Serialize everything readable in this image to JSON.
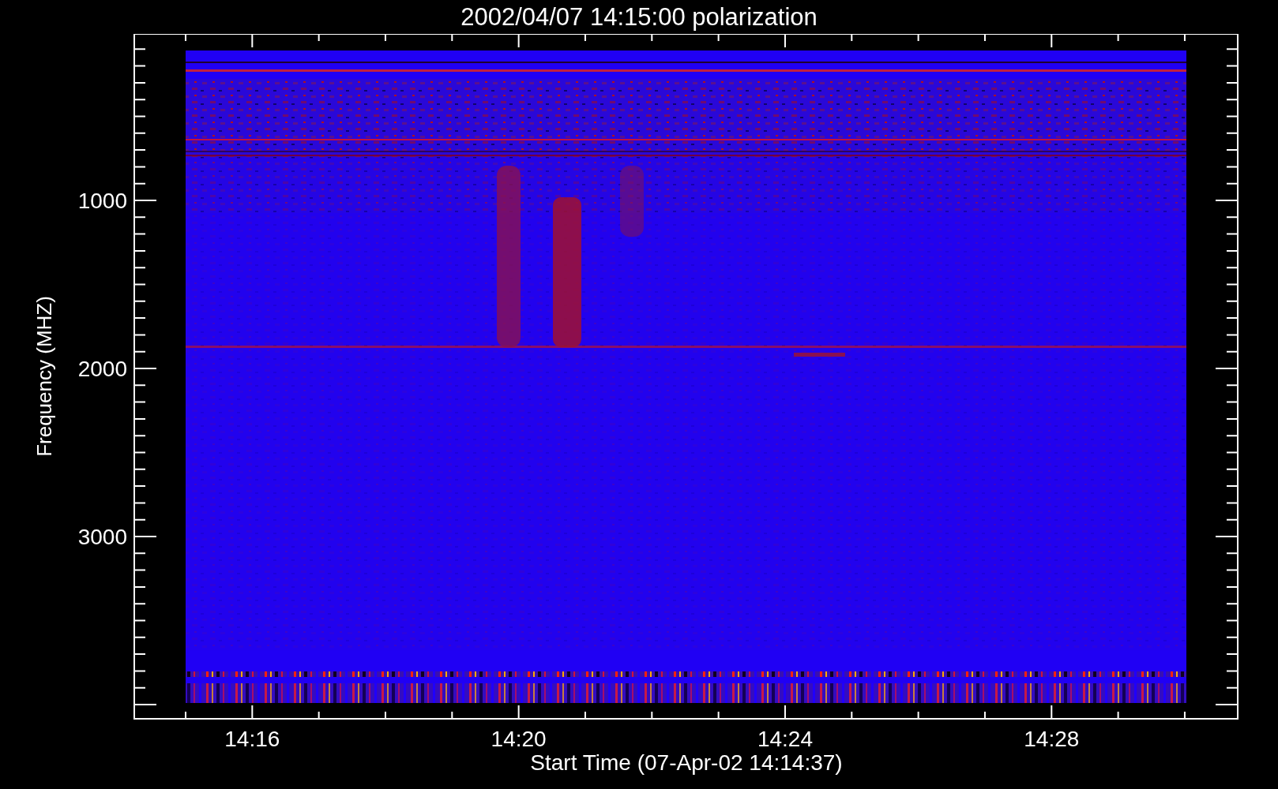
{
  "title": "2002/04/07 14:15:00 polarization",
  "x_axis": {
    "label": "Start Time (07-Apr-02 14:14:37)",
    "ticks": [
      "14:16",
      "14:20",
      "14:24",
      "14:28"
    ]
  },
  "y_axis": {
    "label": "Frequency (MHZ)",
    "ticks": [
      "1000",
      "2000",
      "3000"
    ]
  }
}
